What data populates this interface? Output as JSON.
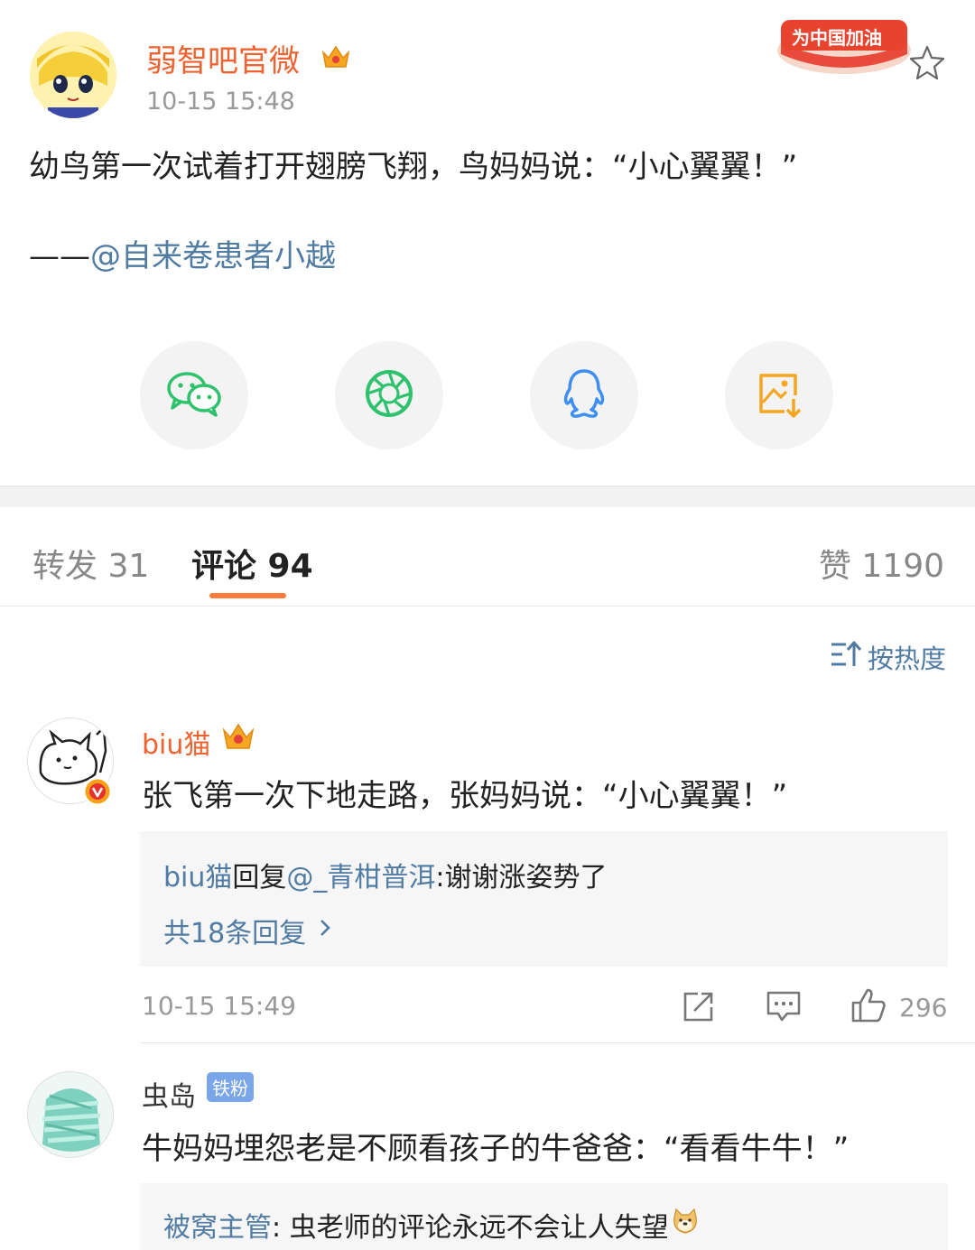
{
  "post": {
    "author": "弱智吧官微",
    "time": "10-15 15:48",
    "text": "幼鸟第一次试着打开翅膀飞翔，鸟妈妈说：“小心翼翼！”",
    "credit_prefix": "——",
    "credit_mention": "@自来卷患者小越",
    "banner_text": "为中国加油"
  },
  "share": {
    "icons": [
      "wechat-icon",
      "moments-icon",
      "qq-icon",
      "save-image-icon"
    ],
    "colors": {
      "wechat": "#2dc26b",
      "moments": "#2dc26b",
      "qq": "#3d8ff2",
      "save": "#f5a623"
    }
  },
  "tabs": {
    "repost": "转发 31",
    "comments": "评论 94",
    "likes": "赞 1190"
  },
  "sort": {
    "label": "按热度"
  },
  "comments": [
    {
      "name": "biu猫",
      "text": "张飞第一次下地走路，张妈妈说：“小心翼翼！”",
      "reply_author": "biu猫",
      "reply_word": "回复",
      "reply_target": "@_青柑普洱",
      "reply_text": ":谢谢涨姿势了",
      "more_replies": "共18条回复",
      "time": "10-15 15:49",
      "likes": "296"
    },
    {
      "name": "虫岛",
      "badge": "铁粉",
      "text": "牛妈妈埋怨老是不顾看孩子的牛爸爸：“看看牛牛！”",
      "reply_author": "被窝主管",
      "reply_text": ": 虫老师的评论永远不会让人失望"
    }
  ],
  "colors": {
    "accent_orange": "#f0622f",
    "link_blue": "#507ba3",
    "tab_underline": "#fa7d3c"
  }
}
